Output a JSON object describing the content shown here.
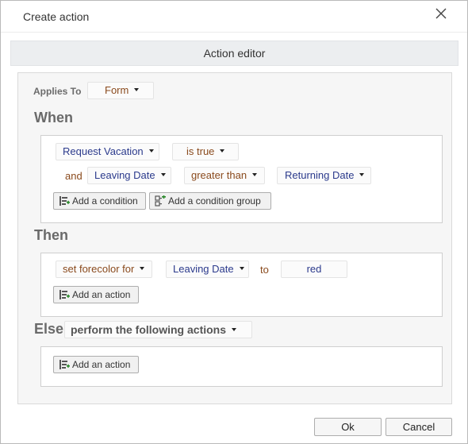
{
  "dialog": {
    "title": "Create action",
    "close_icon": "close-icon"
  },
  "editor": {
    "header": "Action editor",
    "applies_to_label": "Applies To",
    "applies_to_value": "Form"
  },
  "when": {
    "title": "When",
    "row1": {
      "field": "Request Vacation",
      "operator": "is true"
    },
    "row2": {
      "conjunction": "and",
      "field": "Leaving Date",
      "operator": "greater than",
      "value": "Returning Date"
    },
    "add_condition_label": "Add a condition",
    "add_condition_group_label": "Add a condition group"
  },
  "then": {
    "title": "Then",
    "action": "set forecolor for",
    "field": "Leaving Date",
    "to_word": "to",
    "value": "red",
    "add_action_label": "Add an action"
  },
  "else": {
    "title": "Else",
    "mode": "perform the following actions",
    "add_action_label": "Add an action"
  },
  "footer": {
    "ok_label": "Ok",
    "cancel_label": "Cancel"
  },
  "colors": {
    "field_blue": "#2b3a8c",
    "operator_brown": "#8a4a1d"
  }
}
